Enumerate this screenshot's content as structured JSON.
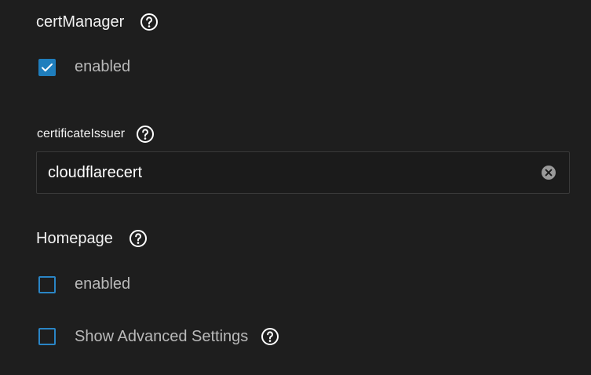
{
  "cert_manager": {
    "title": "certManager",
    "enabled": {
      "label": "enabled",
      "checked": true
    },
    "certificate_issuer": {
      "label": "certificateIssuer",
      "value": "cloudflarecert"
    }
  },
  "homepage": {
    "title": "Homepage",
    "enabled": {
      "label": "enabled",
      "checked": false
    }
  },
  "advanced": {
    "label": "Show Advanced Settings",
    "checked": false
  },
  "colors": {
    "background": "#1e1e1e",
    "accent": "#1f7ebd",
    "checkbox_border": "#2a85c5",
    "muted_text": "#b9b9b9"
  }
}
